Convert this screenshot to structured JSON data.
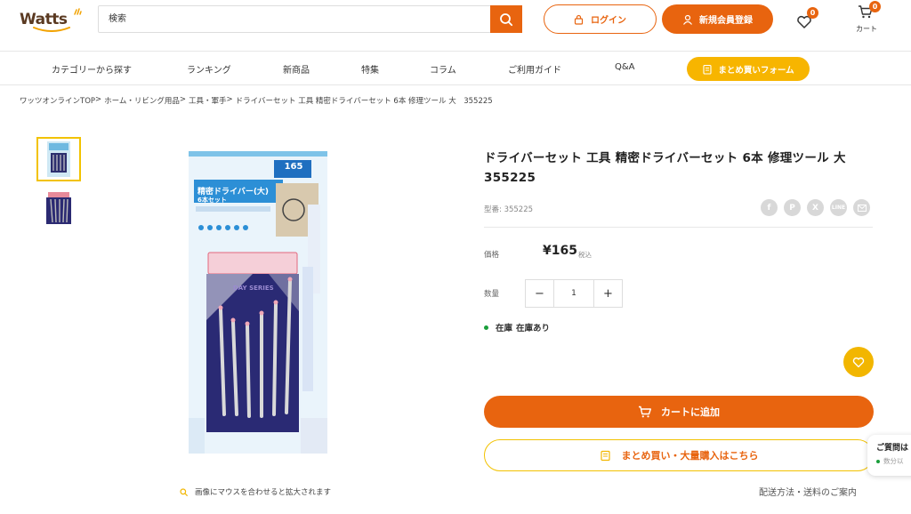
{
  "brand": {
    "logo_text": "Watts"
  },
  "header": {
    "search_placeholder": "検索",
    "login_label": "ログイン",
    "register_label": "新規会員登録",
    "wishlist_count": "0",
    "cart_count": "0",
    "cart_label": "カート"
  },
  "nav": {
    "items": [
      {
        "label": "カテゴリーから探す"
      },
      {
        "label": "ランキング"
      },
      {
        "label": "新商品"
      },
      {
        "label": "特集"
      },
      {
        "label": "コラム"
      },
      {
        "label": "ご利用ガイド"
      },
      {
        "label": "Q&A"
      }
    ],
    "bulk_form_label": "まとめ買いフォーム"
  },
  "breadcrumb": [
    "ワッツオンラインTOP",
    "ホーム・リビング用品",
    "工具・軍手",
    "ドライバーセット 工具 精密ドライバーセット 6本 修理ツール 大　355225"
  ],
  "gallery": {
    "zoom_hint": "画像にマウスを合わせると拡大されます",
    "package_price_tag": "165",
    "package_title": "精密ドライバー(大)",
    "package_subtitle": "6本セット",
    "package_series": "DAY SERIES"
  },
  "product": {
    "title": "ドライバーセット 工具 精密ドライバーセット 6本 修理ツール 大　355225",
    "sku_label": "型番:",
    "sku": "355225",
    "price_label": "価格",
    "price": "¥165",
    "price_tax": "税込",
    "qty_label": "数量",
    "qty_value": "1",
    "stock_label": "在庫",
    "stock_status": "在庫あり",
    "add_to_cart": "カートに追加",
    "bulk_purchase": "まとめ買い・大量購入はこちら",
    "shipping_link": "配送方法・送料のご案内"
  },
  "share_icons": [
    "facebook-icon",
    "pinterest-icon",
    "x-icon",
    "line-icon",
    "mail-icon"
  ],
  "chat": {
    "title": "ご質問は",
    "status": "数分以"
  },
  "colors": {
    "accent": "#e8640f",
    "yellow": "#f2b600",
    "stock_green": "#1a9e3b"
  }
}
